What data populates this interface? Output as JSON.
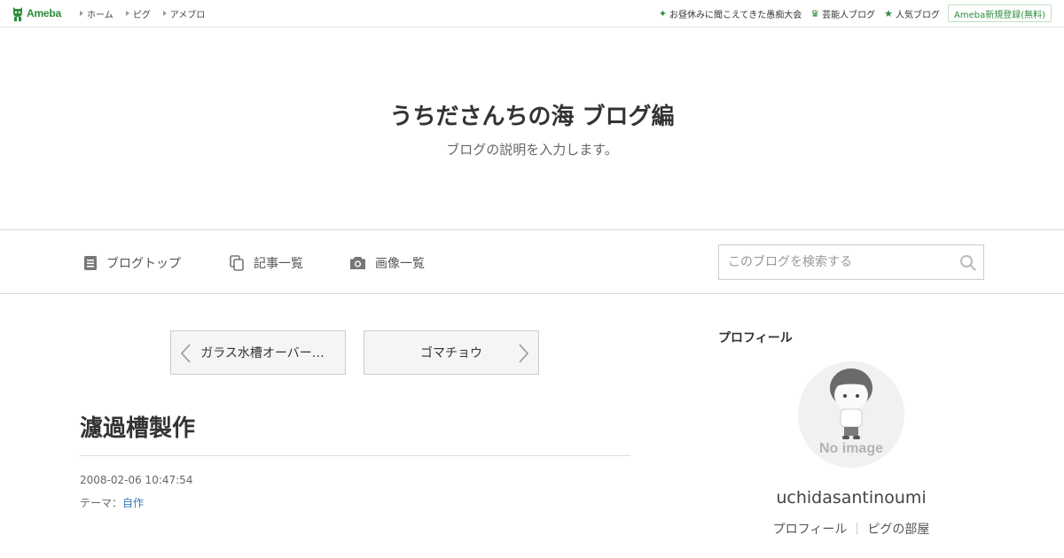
{
  "topbar": {
    "logo": "Ameba",
    "nav": [
      "ホーム",
      "ピグ",
      "アメブロ"
    ],
    "right": [
      {
        "icon": "sparkle-icon",
        "label": "お昼休みに聞こえてきた愚痴大会"
      },
      {
        "icon": "crown-icon",
        "label": "芸能人ブログ"
      },
      {
        "icon": "star-icon",
        "label": "人気ブログ"
      }
    ],
    "signup": "Ameba新規登録(無料)"
  },
  "header": {
    "title": "うちださんちの海 ブログ編",
    "description": "ブログの説明を入力します。"
  },
  "nav": {
    "top": "ブログトップ",
    "entries": "記事一覧",
    "images": "画像一覧",
    "search_placeholder": "このブログを検索する"
  },
  "pager": {
    "prev": "ガラス水槽オーバー…",
    "next": "ゴマチョウ"
  },
  "entry": {
    "title": "濾過槽製作",
    "date": "2008-02-06 10:47:54",
    "theme_label": "テーマ：",
    "theme": "自作"
  },
  "sidebar": {
    "profile_heading": "プロフィール",
    "avatar_text": "No image",
    "username": "uchidasantinoumi",
    "links": [
      "プロフィール",
      "ピグの部屋"
    ]
  },
  "colors": {
    "brand": "#2d8c3c",
    "link": "#3a75b5"
  }
}
